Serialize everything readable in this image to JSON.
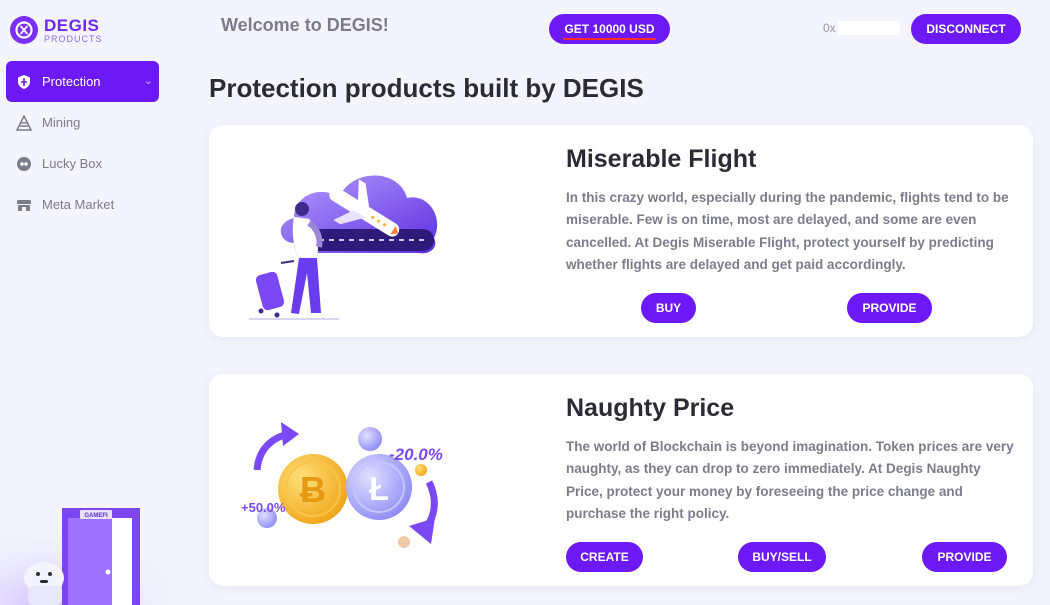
{
  "brand": {
    "name": "DEGIS",
    "sub": "PRODUCTS"
  },
  "sidebar": {
    "items": [
      {
        "label": "Protection",
        "icon": "shield-icon",
        "active": true
      },
      {
        "label": "Mining",
        "icon": "mining-icon",
        "active": false
      },
      {
        "label": "Lucky Box",
        "icon": "lucky-box-icon",
        "active": false
      },
      {
        "label": "Meta Market",
        "icon": "market-icon",
        "active": false
      }
    ]
  },
  "header": {
    "welcome": "Welcome to DEGIS!",
    "get_usd_label": "GET 10000 USD",
    "address_prefix": "0x",
    "disconnect_label": "DISCONNECT"
  },
  "main": {
    "title": "Protection products built by DEGIS",
    "products": [
      {
        "title": "Miserable Flight",
        "description": "In this crazy world, especially during the pandemic, flights tend to be miserable. Few is on time, most are delayed, and some are even cancelled. At Degis Miserable Flight, protect yourself by predicting whether flights are delayed and get paid accordingly.",
        "buttons": [
          "BUY",
          "PROVIDE"
        ]
      },
      {
        "title": "Naughty Price",
        "description": "The world of Blockchain is beyond imagination. Token prices are very naughty, as they can drop to zero immediately. At Degis Naughty Price, protect your money by foreseeing the price change and purchase the right policy.",
        "buttons": [
          "CREATE",
          "BUY/SELL",
          "PROVIDE"
        ],
        "illustration_labels": {
          "up": "+50.0%",
          "down": "-20.0%"
        }
      }
    ]
  },
  "mascot": {
    "sign": "GAMEFI"
  },
  "colors": {
    "accent": "#6c19f5",
    "background": "#f3f4fd",
    "text": "#2b2b36",
    "muted": "#7c7d8c",
    "underline": "#ff2a2a"
  }
}
